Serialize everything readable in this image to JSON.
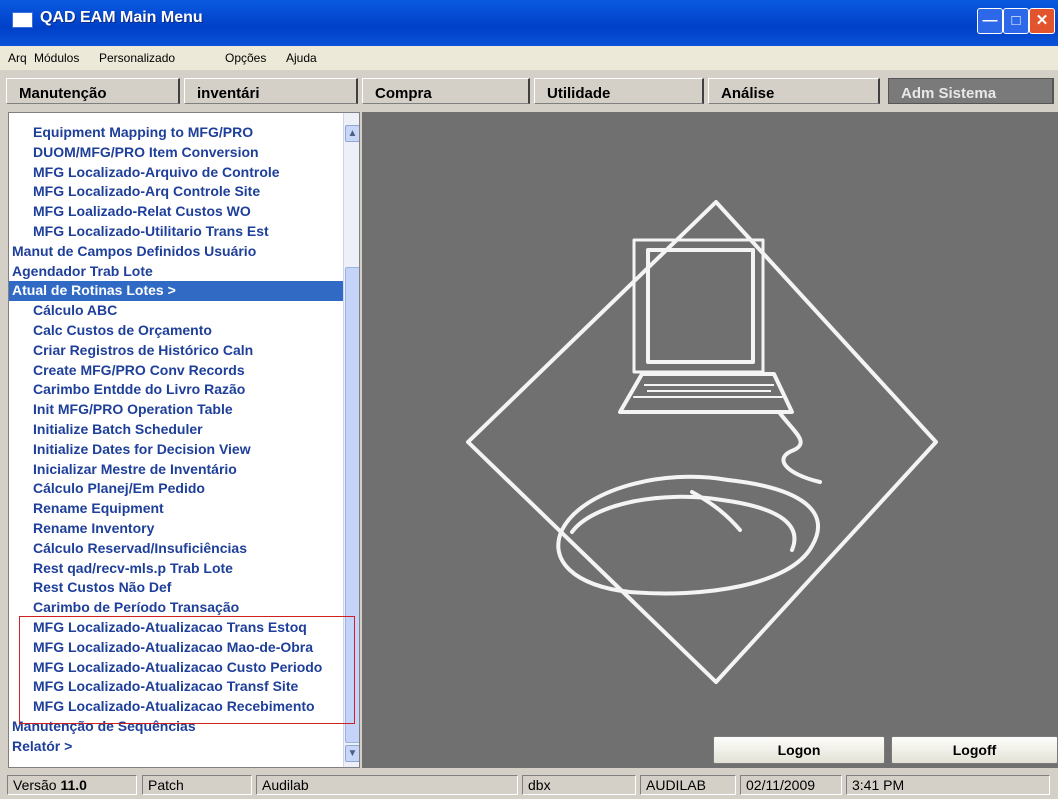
{
  "window": {
    "title": "QAD EAM Main Menu"
  },
  "menubar": {
    "items": [
      "Arq",
      "Módulos",
      "Personalizado",
      "Opções",
      "Ajuda"
    ]
  },
  "tabs": [
    "Manutenção",
    "inventári",
    "Compra",
    "Utilidade",
    "Análise",
    "Adm Sistema"
  ],
  "active_tab": "Adm Sistema",
  "menu_items": [
    "Equipment Mapping to MFG/PRO",
    "DUOM/MFG/PRO Item Conversion",
    "MFG Localizado-Arquivo de Controle",
    "MFG Localizado-Arq Controle Site",
    "MFG Loalizado-Relat Custos WO",
    "MFG Localizado-Utilitario Trans Est",
    "Manut de Campos Definidos Usuário",
    "Agendador Trab Lote",
    "Atual de Rotinas Lotes >",
    "Cálculo ABC",
    "Calc Custos de Orçamento",
    "Criar Registros de Histórico Caln",
    "Create MFG/PRO Conv Records",
    "Carimbo Entdde do Livro Razão",
    "Init MFG/PRO Operation Table",
    "Initialize Batch Scheduler",
    "Initialize Dates for Decision View",
    "Inicializar Mestre de Inventário",
    "Cálculo Planej/Em Pedido",
    "Rename Equipment",
    "Rename Inventory",
    "Cálculo Reservad/Insuficiências",
    "Rest qad/recv-mls.p Trab Lote",
    "Rest Custos Não Def",
    "Carimbo de Período Transação",
    "MFG Localizado-Atualizacao Trans Estoq",
    "MFG Localizado-Atualizacao Mao-de-Obra",
    "MFG Localizado-Atualizacao Custo Periodo",
    "MFG Localizado-Atualizacao Transf Site",
    "MFG Localizado-Atualizacao Recebimento",
    "Manutenção de Sequências",
    "Relatór >"
  ],
  "selected_menu_item": "Atual de Rotinas Lotes >",
  "buttons": {
    "logon": "Logon",
    "logoff": "Logoff"
  },
  "status": {
    "version_label": "Versão",
    "version": "11.0",
    "patch": "Patch",
    "company": "Audilab",
    "db": "dbx",
    "user": "AUDILAB",
    "date": "02/11/2009",
    "time": "3:41 PM"
  },
  "icons": {
    "window": "app-window-icon",
    "minimize": "minimize-icon",
    "maximize": "maximize-icon",
    "close": "close-icon",
    "scroll_up": "chevron-up-icon",
    "scroll_down": "chevron-down-icon",
    "splash": "computer-mouse-illustration"
  }
}
